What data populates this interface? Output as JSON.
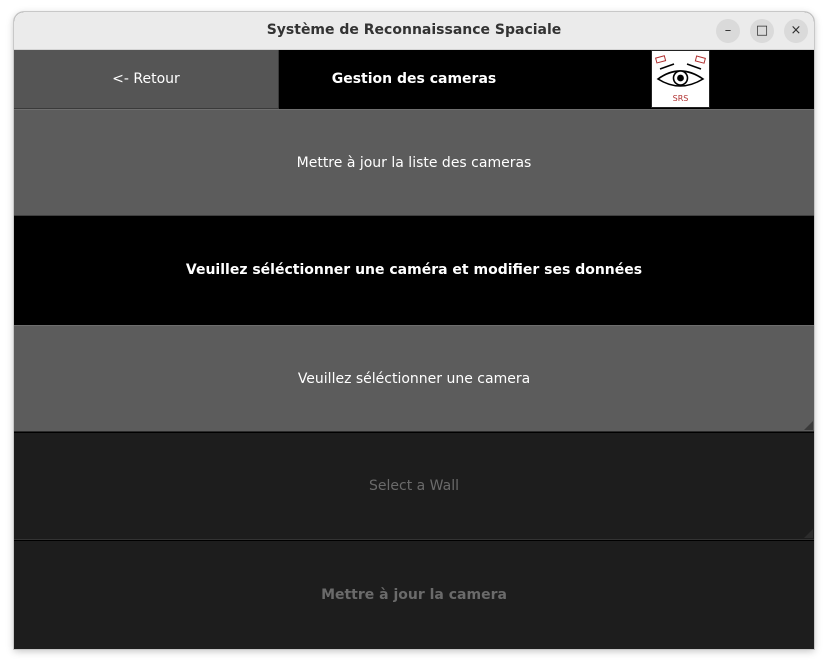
{
  "window": {
    "title": "Système de Reconnaissance Spaciale",
    "controls": {
      "minimize": "–",
      "maximize": "□",
      "close": "×"
    }
  },
  "header": {
    "back_label": "<- Retour",
    "title": "Gestion des cameras",
    "logo_text": "SRS"
  },
  "main": {
    "refresh_button": "Mettre à jour la liste des cameras",
    "instruction": "Veuillez séléctionner une caméra et modifier ses données",
    "camera_select": {
      "value": "Veuillez séléctionner une camera"
    },
    "wall_select": {
      "value": "Select a Wall"
    },
    "update_button": "Mettre à jour la camera"
  }
}
